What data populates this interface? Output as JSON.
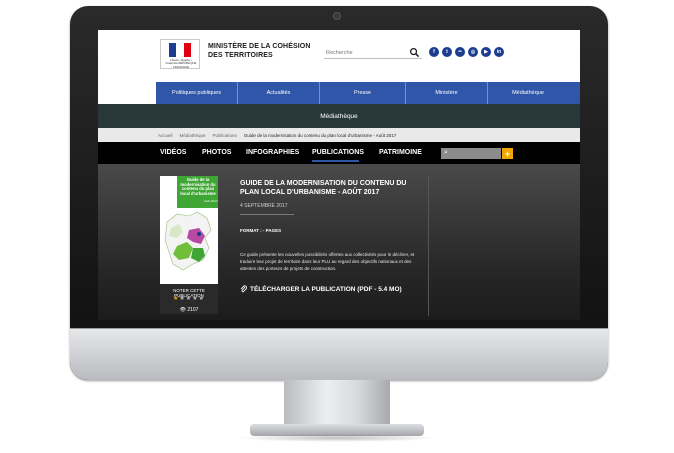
{
  "header": {
    "logo_text": "Liberté • Égalité • Fraternité RÉPUBLIQUE FRANÇAISE",
    "ministry": "MINISTÈRE DE LA COHÉSION DES TERRITOIRES",
    "search": {
      "placeholder": "Recherche"
    },
    "socials": [
      "f",
      "t",
      "••",
      "◎",
      "▶",
      "in"
    ]
  },
  "nav": {
    "items": [
      {
        "label": "Politiques publiques"
      },
      {
        "label": "Actualités"
      },
      {
        "label": "Presse"
      },
      {
        "label": "Ministère"
      },
      {
        "label": "Médiathèque"
      }
    ]
  },
  "band": {
    "title": "Médiathèque"
  },
  "breadcrumb": {
    "items": [
      "Accueil",
      "Médiathèque",
      "Publications"
    ],
    "current": "Guide de la modernisation du contenu du plan local d'urbanisme - Août 2017"
  },
  "tabs": {
    "items": [
      {
        "label": "VIDÉOS"
      },
      {
        "label": "PHOTOS"
      },
      {
        "label": "INFOGRAPHIES"
      },
      {
        "label": "PUBLICATIONS"
      },
      {
        "label": "PATRIMOINE"
      }
    ],
    "active": "PUBLICATIONS",
    "plus": "+"
  },
  "publication": {
    "cover_title": "Guide de la modernisation du contenu du plan local d'urbanisme",
    "cover_date": "Août 2017",
    "rate_label": "NOTER CETTE PUBLICATION",
    "rating": 1,
    "rating_max": 5,
    "views": "2107",
    "title": "GUIDE DE LA MODERNISATION DU CONTENU DU PLAN LOCAL D'URBANISME - AOÛT 2017",
    "date": "4 SEPTEMBRE 2017",
    "format": "FORMAT : - PAGES",
    "description": "Ce guide présente les nouvelles possibilités offertes aux collectivités pour le décliner, et traduire leur projet de territoire dans leur PLU au regard des objectifs nationaux et des attentes des porteurs de projets de construction.",
    "download": "TÉLÉCHARGER LA PUBLICATION (PDF - 5.4 MO)"
  },
  "colors": {
    "nav_blue": "#2f56a8",
    "band": "#28373a",
    "accent_orange": "#f0a800",
    "cover_green": "#3fa535",
    "star_gold": "#f0a800"
  }
}
